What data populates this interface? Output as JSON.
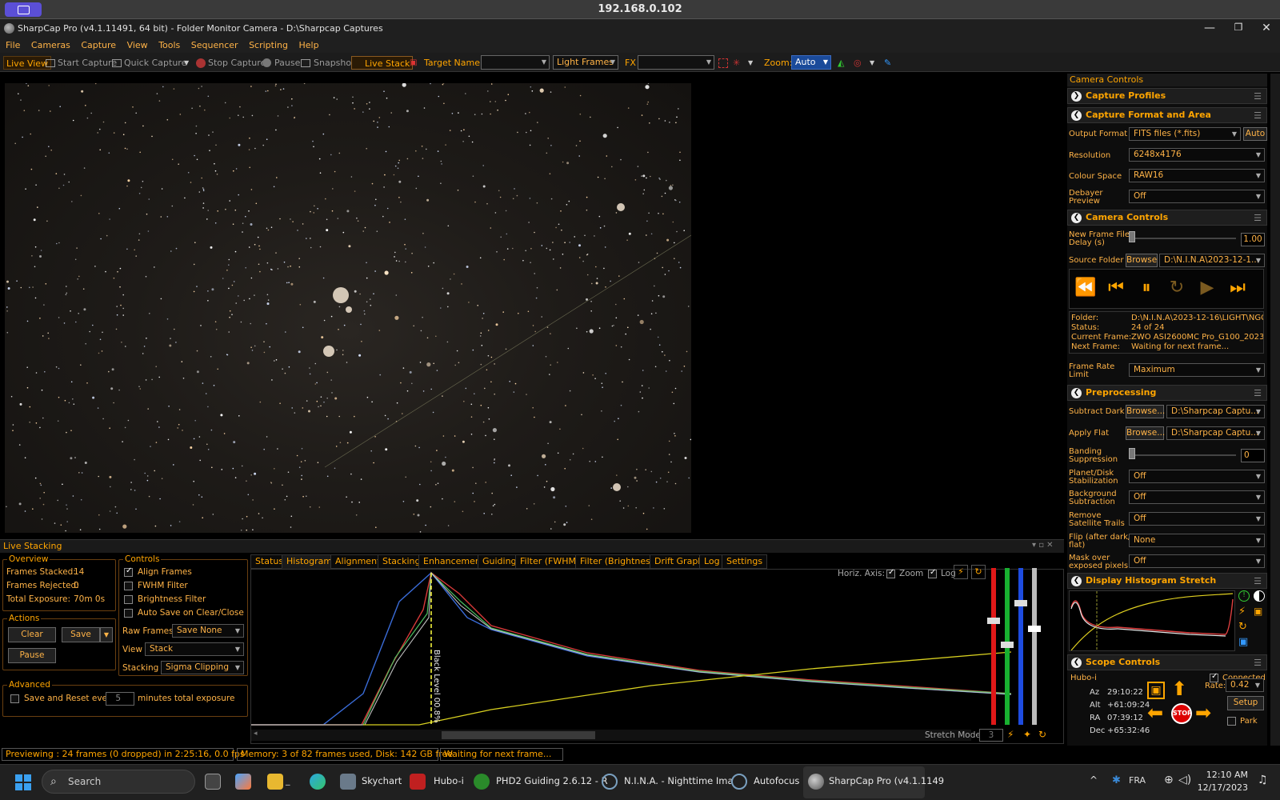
{
  "rdp": {
    "ip": "192.168.0.102"
  },
  "window": {
    "title": "SharpCap Pro (v4.1.11491, 64 bit) - Folder Monitor Camera - D:\\Sharpcap Captures",
    "min": "—",
    "max": "❐",
    "close": "✕"
  },
  "menu": [
    "File",
    "Cameras",
    "Capture",
    "View",
    "Tools",
    "Sequencer",
    "Scripting",
    "Help"
  ],
  "toolbar": {
    "live_view": "Live View",
    "start_capture": "Start Capture",
    "quick_capture": "Quick Capture",
    "stop_capture": "Stop Capture",
    "pause": "Pause",
    "snapshot": "Snapshot",
    "live_stack": "Live Stack",
    "target_name_label": "Target Name :",
    "target_name_value": "",
    "frame_type": "Light Frames",
    "fx_label": "FX",
    "fx_value": "",
    "zoom_label": "Zoom:",
    "zoom_value": "Auto"
  },
  "right_panel": {
    "title": "Camera Controls",
    "capture_profiles": "Capture Profiles",
    "capture_format": {
      "header": "Capture Format and Area",
      "output_format_label": "Output Format",
      "output_format": "FITS files (*.fits)",
      "auto": "Auto",
      "resolution_label": "Resolution",
      "resolution": "6248x4176",
      "colour_space_label": "Colour Space",
      "colour_space": "RAW16",
      "debayer_label1": "Debayer",
      "debayer_label2": "Preview",
      "debayer": "Off"
    },
    "camera_controls": {
      "header": "Camera Controls",
      "delay_label1": "New Frame File",
      "delay_label2": "Delay (s)",
      "delay_value": "1.00",
      "delay_fraction": 0.0,
      "source_folder_label": "Source Folder",
      "browse": "Browse",
      "source_folder": "D:\\N.I.N.A\\2023-12-1...",
      "folder_label": "Folder:",
      "folder": "D:\\N.I.N.A\\2023-12-16\\LIGHT\\NGC",
      "status_label": "Status:",
      "status": "24 of 24",
      "current_label": "Current Frame:",
      "current": "ZWO ASI2600MC Pro_G100_2023",
      "next_label": "Next Frame:",
      "next": "Waiting for next frame...",
      "frame_rate_label1": "Frame Rate",
      "frame_rate_label2": "Limit",
      "frame_rate": "Maximum"
    },
    "preprocessing": {
      "header": "Preprocessing",
      "subtract_dark_label": "Subtract Dark",
      "browse_dots": "Browse...",
      "dark_path": "D:\\Sharpcap Captu...",
      "apply_flat_label": "Apply Flat",
      "flat_path": "D:\\Sharpcap Captu...",
      "banding_label1": "Banding",
      "banding_label2": "Suppression",
      "banding_value": "0",
      "planet_label1": "Planet/Disk",
      "planet_label2": "Stabilization",
      "planet": "Off",
      "bg_label1": "Background",
      "bg_label2": "Subtraction",
      "bg": "Off",
      "sat_label1": "Remove",
      "sat_label2": "Satellite Trails",
      "sat": "Off",
      "flip_label1": "Flip (after dark/",
      "flip_label2": "flat)",
      "flip": "None",
      "mask_label1": "Mask over",
      "mask_label2": "exposed pixels",
      "mask": "Off"
    },
    "display_histogram": {
      "header": "Display Histogram Stretch"
    },
    "scope_controls": {
      "header": "Scope Controls",
      "mount": "Hubo-i",
      "connected": "Connected",
      "az_label": "Az",
      "az": "29:10:22",
      "alt_label": "Alt",
      "alt": "+61:09:24",
      "ra_label": "RA",
      "ra": "07:39:12",
      "dec_label": "Dec",
      "dec": "+65:32:46",
      "rate_label": "Rate:",
      "rate": "0.42",
      "setup": "Setup",
      "park": "Park",
      "stop": "STOP"
    }
  },
  "live_stacking": {
    "title": "Live Stacking",
    "overview": {
      "label": "Overview",
      "frames_stacked_label": "Frames Stacked:",
      "frames_stacked": "14",
      "frames_rejected_label": "Frames Rejected:",
      "frames_rejected": "0",
      "total_exposure_label": "Total Exposure:",
      "total_exposure": "70m 0s"
    },
    "actions": {
      "label": "Actions",
      "clear": "Clear",
      "save": "Save",
      "pause": "Pause"
    },
    "advanced": {
      "label": "Advanced",
      "save_reset": "Save and Reset every",
      "minutes": "5",
      "suffix": "minutes total exposure"
    },
    "controls": {
      "label": "Controls",
      "align": "Align Frames",
      "fwhm": "FWHM Filter",
      "brightness": "Brightness Filter",
      "autosave": "Auto Save on Clear/Close",
      "raw_frames_label": "Raw Frames",
      "raw_frames": "Save None",
      "view_label": "View",
      "view": "Stack",
      "stacking_label": "Stacking",
      "stacking": "Sigma Clipping"
    },
    "tabs": [
      "Status",
      "Histogram",
      "Alignment",
      "Stacking",
      "Enhancement",
      "Guiding",
      "Filter (FWHM)",
      "Filter (Brightness)",
      "Drift Graph",
      "Log",
      "Settings"
    ],
    "histogram": {
      "horiz_axis": "Horiz. Axis:",
      "zoom": "Zoom",
      "log": "Log",
      "black_level": "Black Level 00.8%",
      "stretch_mode": "Stretch Mode",
      "stretch_value": "3"
    }
  },
  "status_bar": {
    "preview": "Previewing : 24 frames (0 dropped) in 2:25:16, 0.0 fps",
    "memory": "Memory: 3 of 82 frames used, Disk: 142 GB free",
    "waiting": "Waiting for next frame..."
  },
  "taskbar": {
    "search": "Search",
    "apps": [
      "Skychart",
      "Hubo-i",
      "PHD2 Guiding 2.6.12 - R",
      "N.I.N.A. - Nighttime Ima",
      "Autofocus",
      "SharpCap Pro (v4.1.1149"
    ],
    "lang": "FRA",
    "time": "12:10 AM",
    "date": "12/17/2023"
  },
  "colors": {
    "accent": "#ffa500",
    "bg": "#000000"
  }
}
